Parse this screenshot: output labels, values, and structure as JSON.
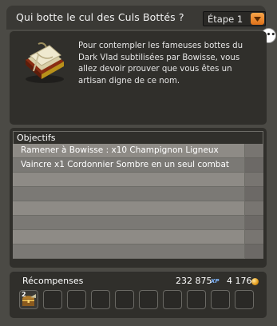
{
  "quest": {
    "title": "Qui botte le cul des Culs Bottés ?",
    "step_selector": "Étape 1",
    "description": "Pour contempler les fameuses bottes du Dark Vlad subtilisées par Bowisse, vous allez devoir prouver que vous êtes un artisan digne de ce nom.",
    "icon": "quest-book-icon"
  },
  "objectives": {
    "header": "Objectifs",
    "items": [
      "Ramener à Bowisse : x10 Champignon Ligneux",
      "Vaincre x1 Cordonnier Sombre en un seul combat"
    ]
  },
  "rewards": {
    "label": "Récompenses",
    "xp": "232 875",
    "xp_tag": "XP",
    "kamas": "4 176",
    "item_count": "2",
    "item_icon": "treasure-chest-icon"
  },
  "colors": {
    "accent": "#f08a2c",
    "panel": "#302f2b",
    "row_light": "#8e8b86",
    "row_dark": "#7b7975"
  }
}
